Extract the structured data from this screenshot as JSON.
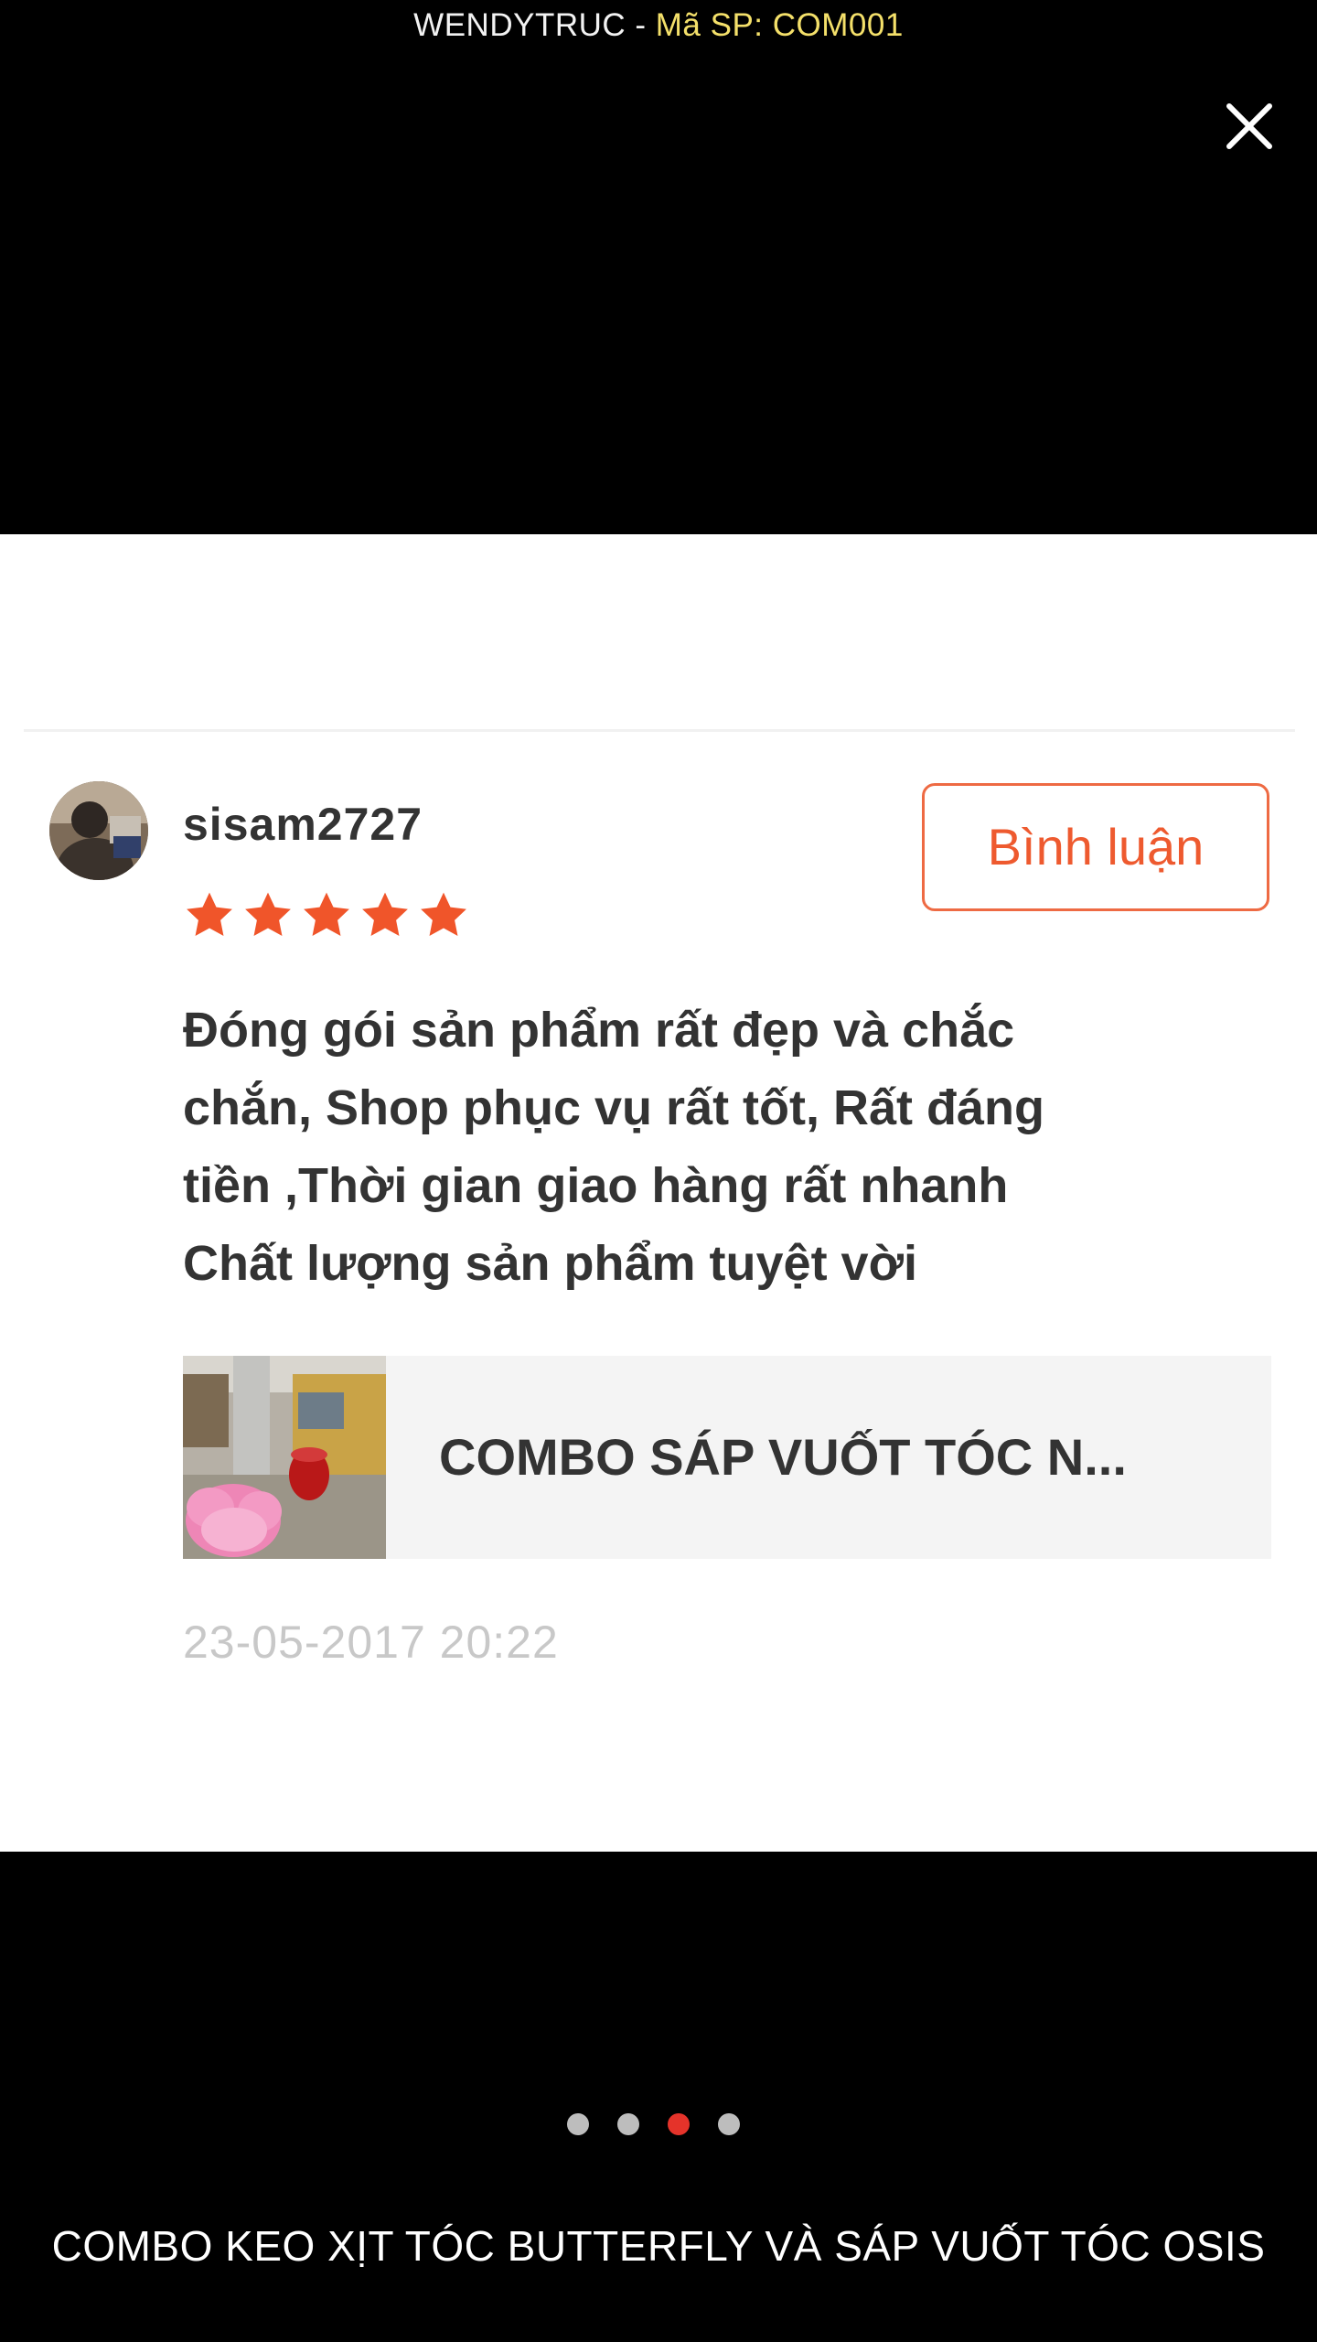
{
  "header": {
    "shop_name": "WENDYTRUC",
    "separator": " - ",
    "product_code": "Mã SP: COM001"
  },
  "review": {
    "username": "sisam2727",
    "rating": 5,
    "rating_max": 5,
    "comment_button_label": "Bình luận",
    "text": "Đóng gói sản phẩm rất đẹp và chắc\nchắn, Shop phục vụ rất tốt, Rất đáng\ntiền ,Thời gian giao hàng rất nhanh\nChất lượng sản phẩm tuyệt vời",
    "product_name": "COMBO SÁP VUỐT TÓC N...",
    "timestamp": "23-05-2017 20:22"
  },
  "pagination": {
    "total": 4,
    "current": 3
  },
  "caption": "COMBO KEO XỊT TÓC BUTTERFLY VÀ SÁP VUỐT TÓC OSIS",
  "colors": {
    "accent": "#ee5a2f",
    "star": "#f0552a",
    "active_dot": "#e5332a",
    "code_text": "#f4e06a"
  }
}
